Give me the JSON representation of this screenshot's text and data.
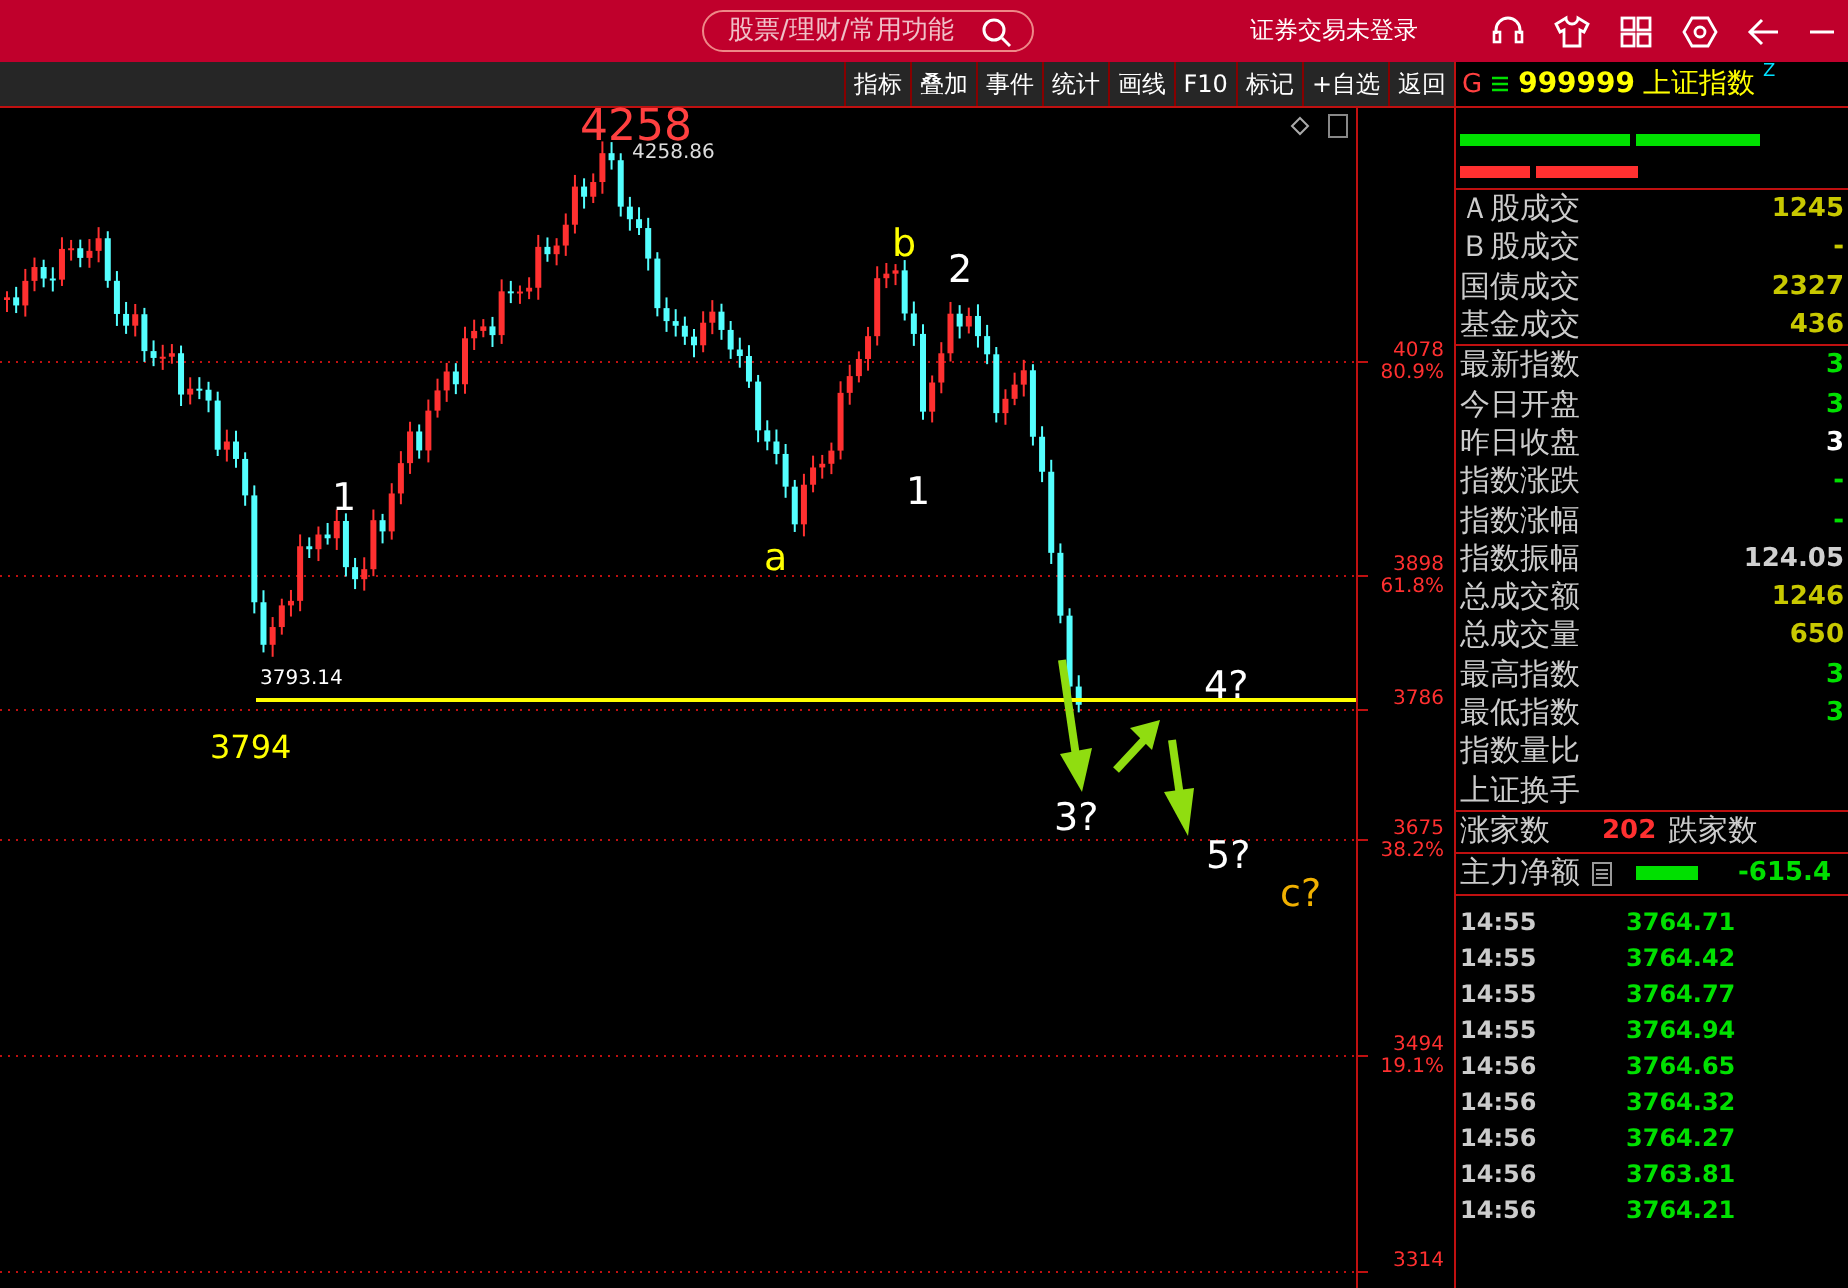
{
  "header": {
    "search_placeholder": "股票/理财/常用功能",
    "login_status": "证券交易未登录"
  },
  "toolbar": [
    "指标",
    "叠加",
    "事件",
    "统计",
    "画线",
    "F10",
    "标记",
    "+自选",
    "返回"
  ],
  "quote": {
    "prefix": "G",
    "code": "999999",
    "name": "上证指数",
    "flag": "Z"
  },
  "stats_a": [
    {
      "label": "Ａ股成交",
      "value": "1245",
      "color": "#c8c800"
    },
    {
      "label": "Ｂ股成交",
      "value": "-",
      "color": "#c8c800"
    },
    {
      "label": "国债成交",
      "value": "2327",
      "color": "#c8c800"
    },
    {
      "label": "基金成交",
      "value": "436",
      "color": "#c8c800"
    }
  ],
  "stats_b": [
    {
      "label": "最新指数",
      "value": "3",
      "color": "#00e000"
    },
    {
      "label": "今日开盘",
      "value": "3",
      "color": "#00e000"
    },
    {
      "label": "昨日收盘",
      "value": "3",
      "color": "#ffffff"
    },
    {
      "label": "指数涨跌",
      "value": "-",
      "color": "#00e000"
    },
    {
      "label": "指数涨幅",
      "value": "-",
      "color": "#00e000"
    },
    {
      "label": "指数振幅",
      "value": "124.05",
      "color": "#d0d0d0"
    },
    {
      "label": "总成交额",
      "value": "1246",
      "color": "#c8c800"
    },
    {
      "label": "总成交量",
      "value": "650",
      "color": "#c8c800"
    },
    {
      "label": "最高指数",
      "value": "3",
      "color": "#00e000"
    },
    {
      "label": "最低指数",
      "value": "3",
      "color": "#00e000"
    },
    {
      "label": "指数量比"
    },
    {
      "label": "上证换手"
    }
  ],
  "breadth": {
    "up_label": "涨家数",
    "up_count": "202",
    "down_label": "跌家数"
  },
  "net_flow": {
    "label": "主力净额",
    "value": "-615.4"
  },
  "ticks": [
    {
      "time": "14:55",
      "price": "3764.71"
    },
    {
      "time": "14:55",
      "price": "3764.42"
    },
    {
      "time": "14:55",
      "price": "3764.77"
    },
    {
      "time": "14:55",
      "price": "3764.94"
    },
    {
      "time": "14:56",
      "price": "3764.65"
    },
    {
      "time": "14:56",
      "price": "3764.32"
    },
    {
      "time": "14:56",
      "price": "3764.27"
    },
    {
      "time": "14:56",
      "price": "3763.81"
    },
    {
      "time": "14:56",
      "price": "3764.21"
    }
  ],
  "chart": {
    "axis": [
      {
        "price": "4078",
        "pct": "80.9%"
      },
      {
        "price": "3898",
        "pct": "61.8%"
      },
      {
        "price": "3786"
      },
      {
        "price": "3675",
        "pct": "38.2%"
      },
      {
        "price": "3494",
        "pct": "19.1%"
      },
      {
        "price": "3314"
      }
    ],
    "peak_label": "4258",
    "peak_value": "4258.86",
    "low_value": "3793.14",
    "low_label": "3794",
    "wave_labels": [
      {
        "text": "1",
        "color": "#ffffff"
      },
      {
        "text": "a",
        "color": "#ffff00"
      },
      {
        "text": "b",
        "color": "#ffff00"
      },
      {
        "text": "2",
        "color": "#ffffff"
      },
      {
        "text": "1",
        "color": "#ffffff"
      },
      {
        "text": "3?",
        "color": "#ffffff"
      },
      {
        "text": "4?",
        "color": "#ffffff"
      },
      {
        "text": "5?",
        "color": "#ffffff"
      },
      {
        "text": "c?",
        "color": "#f0b000"
      }
    ]
  }
}
